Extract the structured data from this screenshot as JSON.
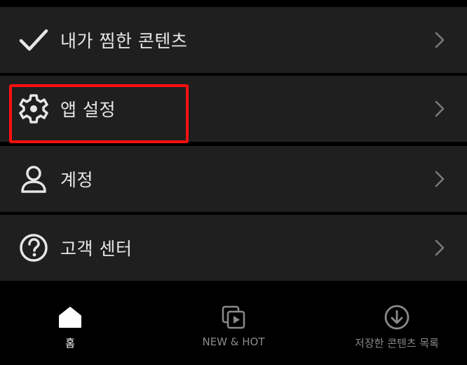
{
  "menu": {
    "items": [
      {
        "label": "내가 찜한 콘텐츠",
        "icon": "checkmark-icon"
      },
      {
        "label": "앱 설정",
        "icon": "gear-icon"
      },
      {
        "label": "계정",
        "icon": "user-icon"
      },
      {
        "label": "고객 센터",
        "icon": "help-icon"
      }
    ]
  },
  "tabbar": {
    "tabs": [
      {
        "label": "홈",
        "icon": "home-icon",
        "active": true
      },
      {
        "label": "NEW & HOT",
        "icon": "new-hot-icon",
        "active": false
      },
      {
        "label": "저장한 콘텐츠 목록",
        "icon": "download-icon",
        "active": false
      }
    ]
  },
  "colors": {
    "row_background": "#1f1f1f",
    "background": "#000000",
    "highlight": "#ff1010",
    "text": "#e6e6e6",
    "inactive_tab": "#8a8a8a"
  }
}
